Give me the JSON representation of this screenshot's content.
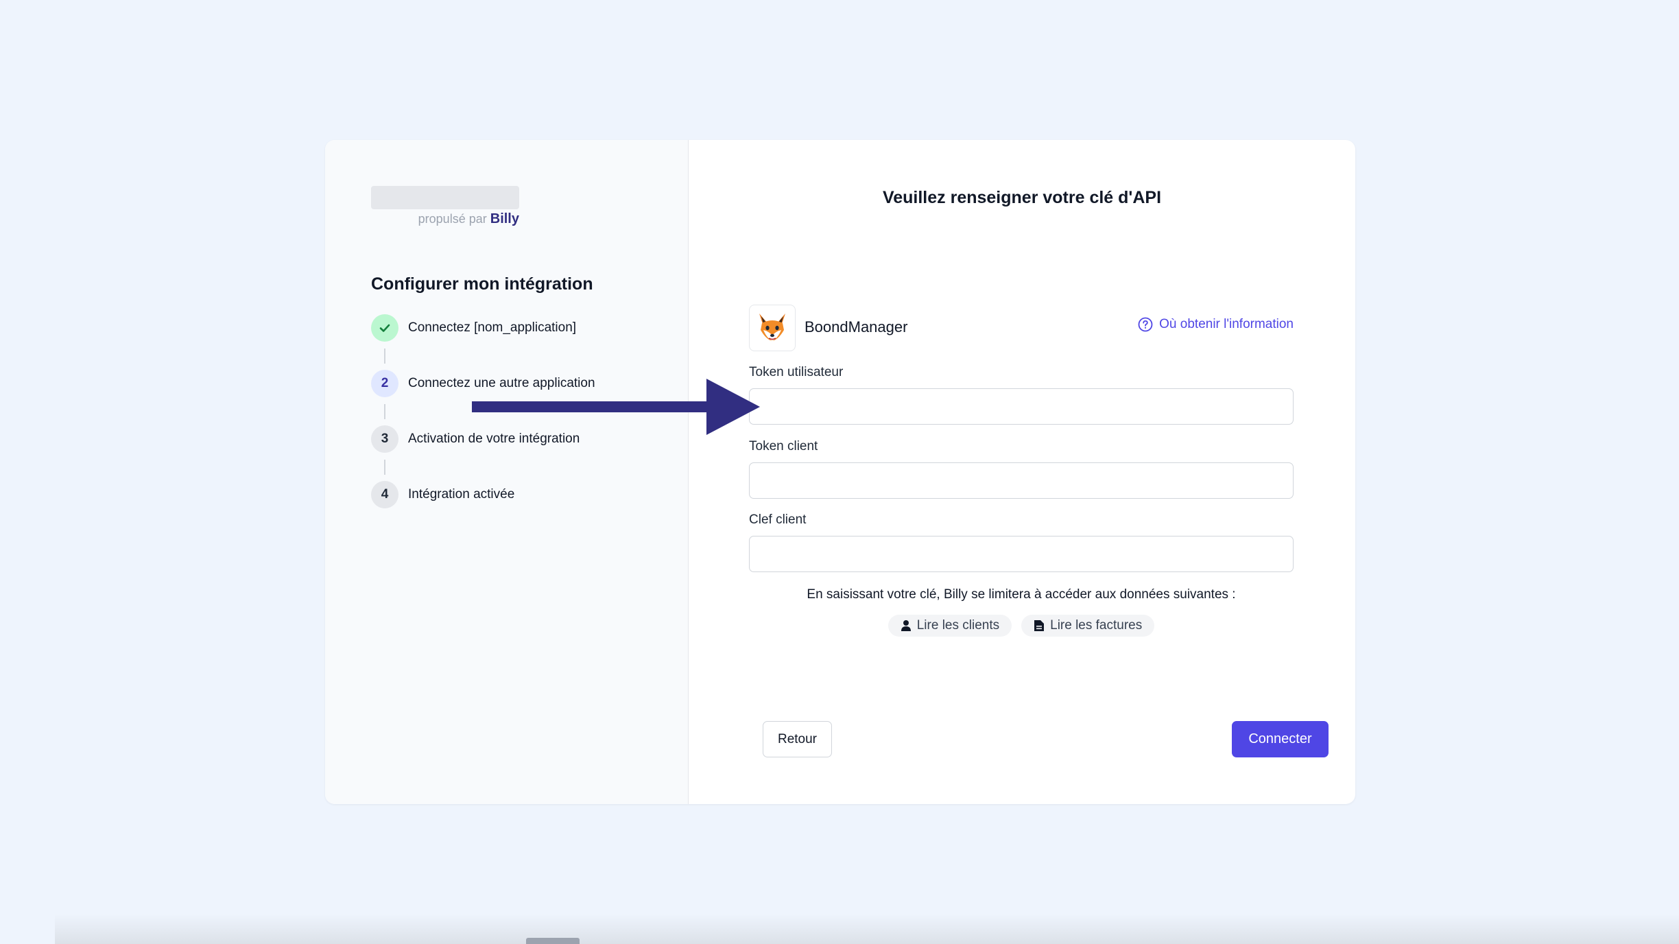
{
  "sidebar": {
    "powered_prefix": "propulsé par",
    "powered_brand": "Billy",
    "title": "Configurer mon intégration",
    "steps": [
      {
        "number": "",
        "label": "Connectez [nom_application]",
        "state": "done",
        "icon": "check-icon"
      },
      {
        "number": "2",
        "label": "Connectez une autre application",
        "state": "active"
      },
      {
        "number": "3",
        "label": "Activation de votre intégration",
        "state": "todo"
      },
      {
        "number": "4",
        "label": "Intégration activée",
        "state": "todo"
      }
    ]
  },
  "main": {
    "title": "Veuillez renseigner votre clé d'API",
    "app": {
      "name": "BoondManager",
      "logo_icon": "fox-logo-icon"
    },
    "help_link": "Où obtenir l'information",
    "fields": [
      {
        "label": "Token utilisateur",
        "value": "",
        "placeholder": ""
      },
      {
        "label": "Token client",
        "value": "",
        "placeholder": ""
      },
      {
        "label": "Clef client",
        "value": "",
        "placeholder": ""
      }
    ],
    "notice": "En saisissant votre clé, Billy se limitera à accéder aux données suivantes :",
    "permissions": [
      {
        "label": "Lire les clients",
        "icon": "user-icon"
      },
      {
        "label": "Lire les factures",
        "icon": "document-icon"
      }
    ],
    "back_label": "Retour",
    "connect_label": "Connecter"
  },
  "colors": {
    "background": "#eef4fd",
    "accent": "#4f46e5",
    "arrow": "#312e81",
    "success": "#15803d",
    "brand": "#312e81"
  }
}
